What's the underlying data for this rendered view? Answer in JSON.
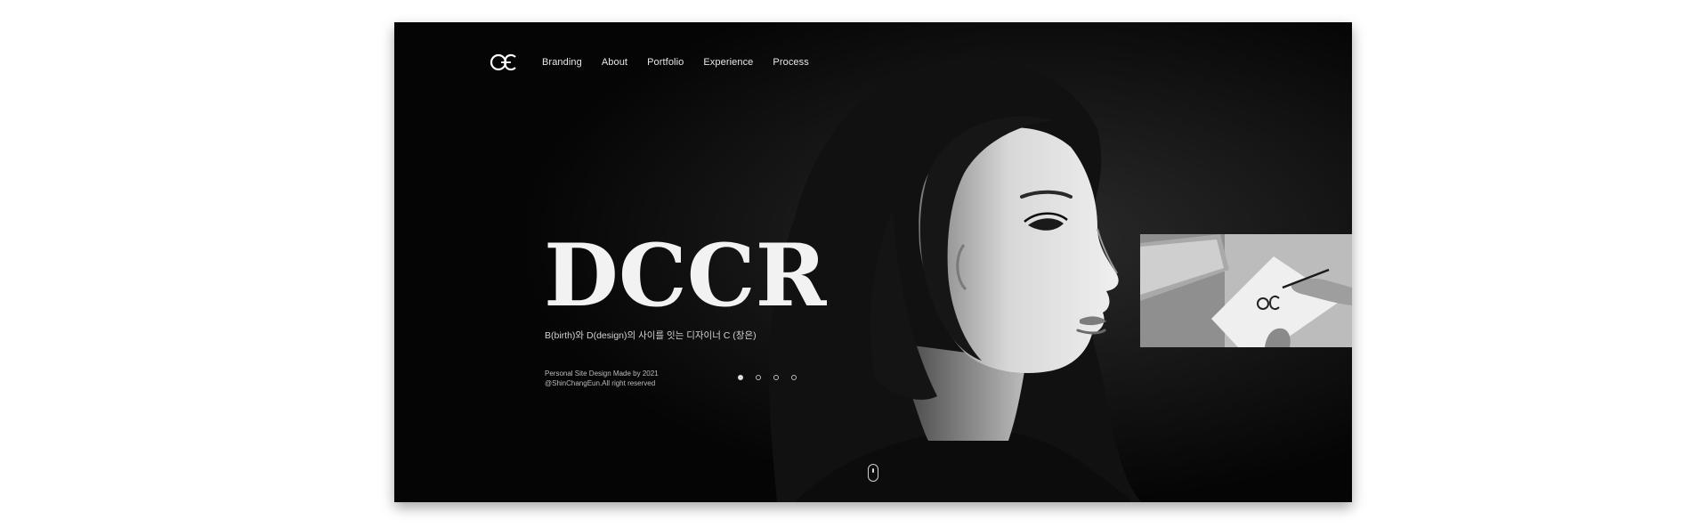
{
  "nav": {
    "logo_text": "CE",
    "items": [
      {
        "label": "Branding"
      },
      {
        "label": "About"
      },
      {
        "label": "Portfolio"
      },
      {
        "label": "Experience"
      },
      {
        "label": "Process"
      }
    ]
  },
  "hero": {
    "title": "DCCR",
    "subtitle": "B(birth)와 D(design)의 사이를 잇는 디자이너 C (창은)",
    "credit_line1": "Personal Site Design Made by 2021",
    "credit_line2": "@ShinChangEun.All right reserved"
  },
  "slider": {
    "count": 4,
    "active_index": 0
  },
  "colors": {
    "background": "#050505",
    "text": "#e8e8e8",
    "page": "#ffffff"
  }
}
